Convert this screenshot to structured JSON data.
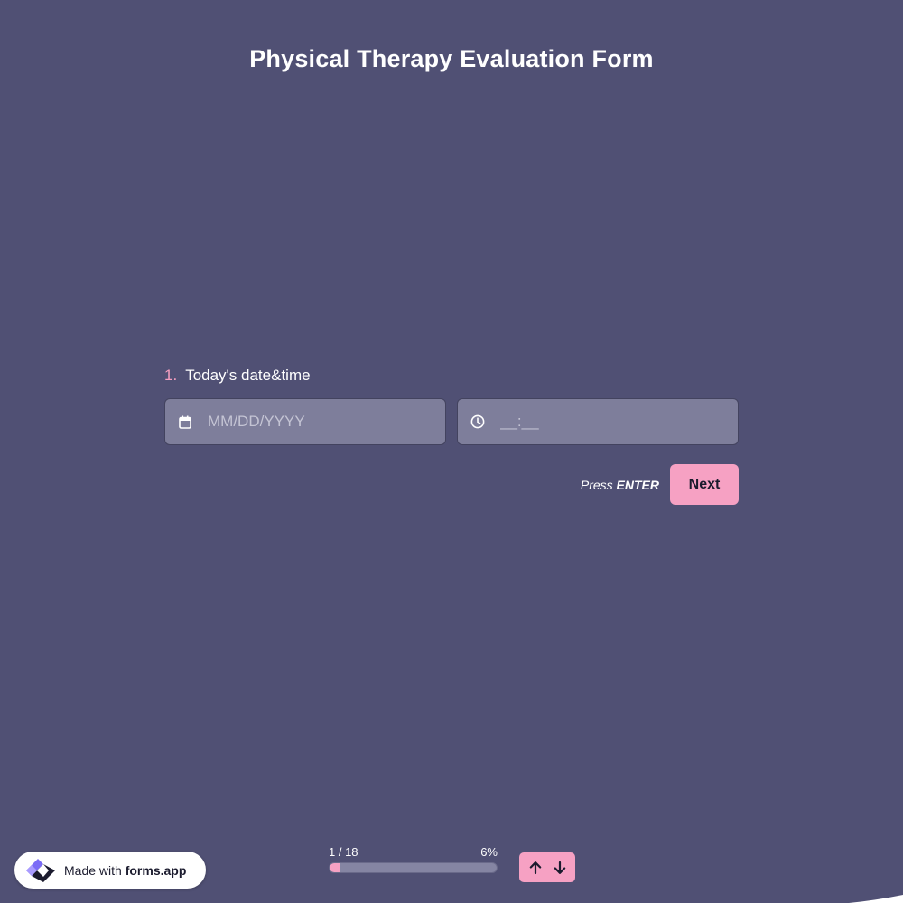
{
  "form": {
    "title": "Physical Therapy Evaluation Form"
  },
  "question": {
    "number": "1.",
    "text": "Today's date&time",
    "date_icon": "calendar-icon",
    "time_icon": "clock-icon",
    "date_placeholder": "MM/DD/YYYY",
    "time_placeholder": "__:__"
  },
  "actions": {
    "press_prefix": "Press",
    "press_key": "ENTER",
    "next_label": "Next"
  },
  "badge": {
    "prefix": "Made with",
    "brand": "forms.app",
    "logo_icon": "forms-app-logo-icon"
  },
  "progress": {
    "counter": "1 / 18",
    "percent_label": "6%",
    "fraction": 0.06
  },
  "nav": {
    "up_icon": "arrow-up-icon",
    "down_icon": "arrow-down-icon"
  },
  "colors": {
    "background": "#505074",
    "accent": "#f6a1c3",
    "field": "#7e7e9b",
    "question_number": "#f69fc0"
  }
}
